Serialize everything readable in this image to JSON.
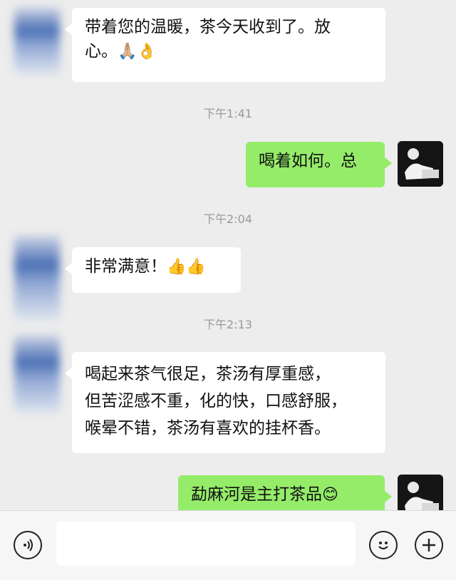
{
  "messages": [
    {
      "side": "left",
      "text_line1": "带着您的温暖，茶今天收到了。放",
      "text_line2": "心。",
      "emoji": "🙏🏼👌"
    },
    {
      "type": "time",
      "text": "下午1:41"
    },
    {
      "side": "right",
      "text": "喝着如何。总"
    },
    {
      "type": "time",
      "text": "下午2:04"
    },
    {
      "side": "left",
      "text": "非常满意！",
      "emoji": "👍👍"
    },
    {
      "type": "time",
      "text": "下午2:13"
    },
    {
      "side": "left",
      "lines": [
        "喝起来茶气很足，茶汤有厚重感，",
        "但苦涩感不重，化的快，口感舒服，",
        "喉晕不错，茶汤有喜欢的挂杯香。"
      ]
    },
    {
      "side": "right",
      "text": "勐麻河是主打茶品",
      "emoji": "😊"
    }
  ],
  "input_bar": {
    "voice_icon": "voice-icon",
    "emoji_icon": "emoji-icon",
    "plus_icon": "plus-icon",
    "placeholder": ""
  },
  "colors": {
    "background": "#ededed",
    "left_bubble": "#ffffff",
    "right_bubble": "#95ec69",
    "timestamp": "#9a9a9a"
  }
}
